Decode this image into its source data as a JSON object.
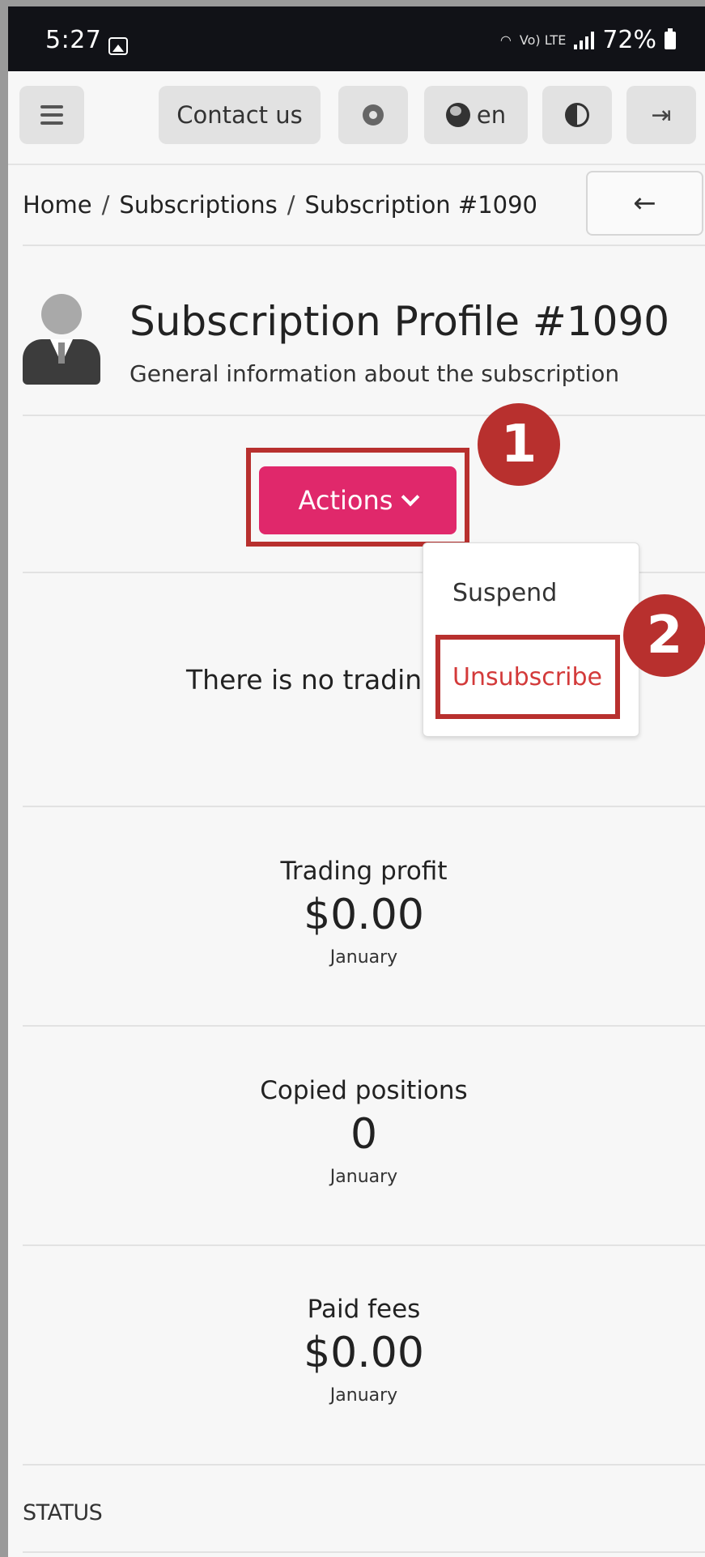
{
  "status_bar": {
    "time": "5:27",
    "signal_tech": "Vo) LTE",
    "battery": "72%"
  },
  "topbar": {
    "menu_icon": "hamburger-icon",
    "contact_label": "Contact us",
    "settings_icon": "gear-icon",
    "language": "en",
    "theme_icon": "contrast-icon",
    "logout_icon": "logout-icon"
  },
  "breadcrumb": {
    "items": [
      "Home",
      "Subscriptions",
      "Subscription #1090"
    ],
    "separator": "/",
    "back_label": "←"
  },
  "header": {
    "title": "Subscription Profile #1090",
    "subtitle": "General information about the subscription"
  },
  "actions": {
    "label": "Actions",
    "menu": [
      "Suspend",
      "Unsubscribe"
    ]
  },
  "annotations": {
    "step1": "1",
    "step2": "2",
    "color": "#b8302e"
  },
  "notice": {
    "text": "There is no trading"
  },
  "stats": [
    {
      "label": "Trading profit",
      "value": "$0.00",
      "period": "January"
    },
    {
      "label": "Copied positions",
      "value": "0",
      "period": "January"
    },
    {
      "label": "Paid fees",
      "value": "$0.00",
      "period": "January"
    }
  ],
  "status_section": {
    "label": "STATUS"
  },
  "colors": {
    "accent": "#e0286b",
    "danger": "#d33a3a",
    "annotation": "#b8302e"
  }
}
